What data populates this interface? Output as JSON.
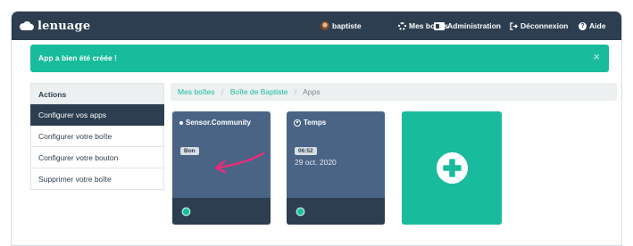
{
  "navbar": {
    "brand": "lenuage",
    "user": "baptiste",
    "boxes": "Mes boîtes",
    "admin": "Administration",
    "logout": "Déconnexion",
    "help": "Aide"
  },
  "alert": {
    "message": "App a bien été créée !",
    "close": "×"
  },
  "sidebar": {
    "heading": "Actions",
    "items": [
      {
        "label": "Configurer vos apps"
      },
      {
        "label": "Configurer votre boîte"
      },
      {
        "label": "Configurer votre bouton"
      },
      {
        "label": "Supprimer votre boîte"
      }
    ]
  },
  "breadcrumb": {
    "items": [
      "Mes boîtes",
      "Boîte de Baptiste",
      "Apps"
    ],
    "separator": "/"
  },
  "apps": [
    {
      "title": "Sensor.Community",
      "badge": "Bon",
      "status_color": "#18bc9c"
    },
    {
      "title": "Temps",
      "badge": "06:52",
      "date": "29 oct. 2020",
      "status_color": "#18bc9c"
    }
  ],
  "colors": {
    "navbar": "#2c3e50",
    "accent": "#18bc9c",
    "card": "#4a6485",
    "annotation_arrow": "#e0307a"
  },
  "icons": {
    "brand": "cloud-icon",
    "user": "avatar",
    "boxes": "cogs-icon",
    "admin": "id-card-icon",
    "logout": "sign-out-icon",
    "help": "question-circle-icon",
    "add": "plus-circle-icon"
  }
}
